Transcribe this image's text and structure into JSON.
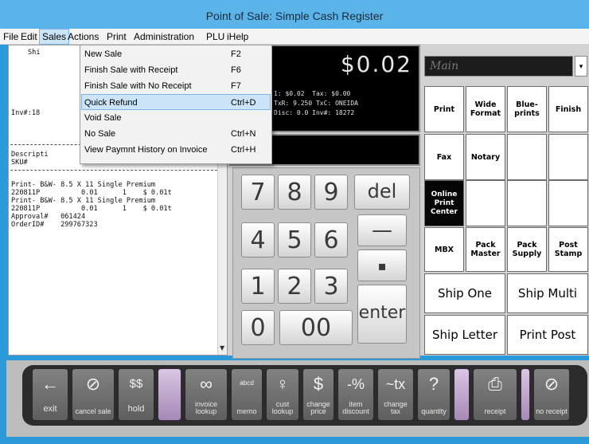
{
  "window": {
    "title": "Point of Sale: Simple Cash Register"
  },
  "menubar": {
    "items": [
      "File",
      "Edit",
      "Sales",
      "Actions",
      "Print",
      "Administration",
      "PLU",
      "iHelp"
    ]
  },
  "sales_menu": [
    {
      "label": "New Sale",
      "shortcut": "F2"
    },
    {
      "label": "Finish Sale with Receipt",
      "shortcut": "F6"
    },
    {
      "label": "Finish Sale with No Receipt",
      "shortcut": "F7"
    },
    {
      "label": "Quick Refund",
      "shortcut": "Ctrl+D"
    },
    {
      "label": "Void Sale",
      "shortcut": ""
    },
    {
      "label": "No Sale",
      "shortcut": "Ctrl+N"
    },
    {
      "label": "View Paymnt History on Invoice",
      "shortcut": "Ctrl+H"
    }
  ],
  "receipt": {
    "header1": "Shi",
    "inv": "Inv#:18",
    "col1": "Descripti",
    "col2": "SKU#",
    "lines": [
      "Print- B&W- 8.5 X 11 Single Premium",
      "220811P          0.01      1    $ 0.01t",
      "Print- B&W- 8.5 X 11 Single Premium",
      "220811P          0.01      1    $ 0.01t",
      "Approval#   061424",
      "OrderID#    299767323"
    ]
  },
  "display": {
    "total": "$0.02",
    "line1": "1: $0.02  Tax: $0.00",
    "line2": "TxR: 9.250 TxC: ONEIDA",
    "line3": "Disc: 0.0 Inv#: 18272"
  },
  "keypad": {
    "keys": [
      "7",
      "8",
      "9",
      "del",
      "4",
      "5",
      "6",
      "—",
      "▪",
      "1",
      "2",
      "3",
      "enter",
      "0",
      "00"
    ]
  },
  "category": {
    "current": "Main",
    "dropdown_icon": "triangle-down-icon"
  },
  "grid": {
    "buttons": [
      "Print",
      "Wide Format",
      "Blue-prints",
      "Finish",
      "Fax",
      "Notary",
      "Online Print Center",
      "MBX",
      "Pack Master",
      "Pack Supply",
      "Post Stamp"
    ],
    "big": [
      "Ship One",
      "Ship Multi",
      "Ship Letter",
      "Print Post"
    ]
  },
  "toolbar": {
    "buttons": [
      {
        "label": "exit",
        "icon": "arrow-left-icon"
      },
      {
        "label": "cancel sale",
        "icon": "no-cart-icon"
      },
      {
        "label": "hold",
        "icon": "dollars-icon"
      },
      {
        "label": "invoice lookup",
        "icon": "binoculars-icon"
      },
      {
        "label": "memo",
        "icon": "memo-icon"
      },
      {
        "label": "cust lookup",
        "icon": "person-icon"
      },
      {
        "label": "change price",
        "icon": "dollar-circle-icon"
      },
      {
        "label": "item discount",
        "icon": "percent-icon"
      },
      {
        "label": "change tax",
        "icon": "tilde-tx-icon"
      },
      {
        "label": "quantity",
        "icon": "question-icon"
      },
      {
        "label": "receipt",
        "icon": "printer-icon"
      },
      {
        "label": "no receipt",
        "icon": "no-printer-icon"
      }
    ]
  },
  "icons": {
    "tb_exit": "←",
    "tb_cancel": "⊘",
    "tb_hold": "$$",
    "tb_invoice": "∞",
    "tb_memo": "ᵃᵇᶜᵈ",
    "tb_cust": "♀",
    "tb_price": "$",
    "tb_disc": "-%",
    "tb_tax": "~tx",
    "tb_qty": "?",
    "tb_receipt": "⎙",
    "tb_noreceipt": "⊘",
    "scroll_down": "▼",
    "cat_dropdown": "▾"
  }
}
